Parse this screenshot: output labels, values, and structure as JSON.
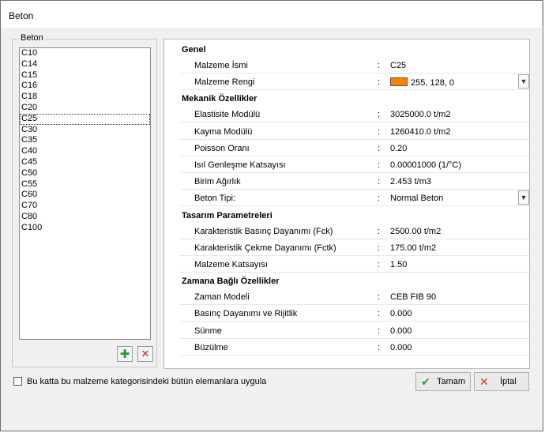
{
  "window": {
    "title": "Beton"
  },
  "materials_group": {
    "legend": "Beton",
    "items": [
      "C10",
      "C14",
      "C15",
      "C16",
      "C18",
      "C20",
      "C25",
      "C30",
      "C35",
      "C40",
      "C45",
      "C50",
      "C55",
      "C60",
      "C70",
      "C80",
      "C100"
    ],
    "selected": "C25"
  },
  "property_grid": {
    "colon": ":",
    "categories": [
      {
        "label": "Genel",
        "rows": [
          {
            "label": "Malzeme İsmi",
            "value": "C25"
          },
          {
            "label": "Malzeme Rengi",
            "value": "255, 128, 0",
            "swatch_color": "#ff8000",
            "dropdown": true
          }
        ]
      },
      {
        "label": "Mekanik Özellikler",
        "rows": [
          {
            "label": "Elastisite Modülü",
            "value": "3025000.0  t/m2"
          },
          {
            "label": "Kayma Modülü",
            "value": "1260410.0  t/m2"
          },
          {
            "label": "Poisson Oranı",
            "value": "0.20"
          },
          {
            "label": "Isıl Genleşme Katsayısı",
            "value": "0.00001000  (1/°C)"
          },
          {
            "label": "Birim Ağırlık",
            "value": "2.453  t/m3"
          },
          {
            "label": "Beton Tipi:",
            "value": "Normal Beton",
            "dropdown": true
          }
        ]
      },
      {
        "label": "Tasarım Parametreleri",
        "rows": [
          {
            "label": "Karakteristik Basınç Dayanımı (Fck)",
            "value": "2500.00  t/m2"
          },
          {
            "label": "Karakteristik Çekme Dayanımı (Fctk)",
            "value": "175.00  t/m2"
          },
          {
            "label": "Malzeme Katsayısı",
            "value": "1.50"
          }
        ]
      },
      {
        "label": "Zamana Bağlı Özellikler",
        "rows": [
          {
            "label": "Zaman Modeli",
            "value": "CEB FIB 90"
          },
          {
            "label": "Basınç Dayanımı ve Rijitlik",
            "value": "0.000"
          },
          {
            "label": "Sünme",
            "value": "0.000"
          },
          {
            "label": "Büzülme",
            "value": "0.000"
          }
        ]
      }
    ]
  },
  "footer": {
    "apply_checkbox_label": "Bu katta bu malzeme kategorisindeki bütün elemanlara uygula",
    "apply_checked": false,
    "ok_label": "Tamam",
    "cancel_label": "İptal"
  },
  "icons": {
    "add": "plus-icon",
    "delete": "x-icon",
    "ok": "checkmark-icon",
    "cancel": "x-icon",
    "dropdown": "chevron-down-icon"
  },
  "glyphs": {
    "plus": "✚",
    "cross": "✕",
    "check": "✔",
    "chevron": "▼"
  }
}
